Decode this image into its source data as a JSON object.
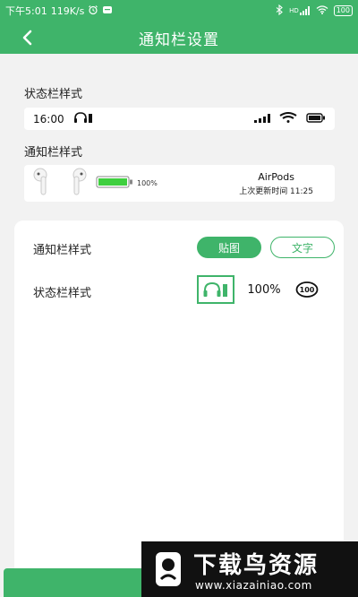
{
  "status_bar": {
    "time": "下午5:01",
    "speed": "119K/s",
    "signal_label": "HD",
    "battery": "100"
  },
  "header": {
    "title": "通知栏设置"
  },
  "preview": {
    "statusbar_section_label": "状态栏样式",
    "statusbar_time": "16:00",
    "notification_section_label": "通知栏样式",
    "notif_battery_pct": "100%",
    "device_name": "AirPods",
    "last_update": "上次更新时间 11:25"
  },
  "settings": {
    "notification_style_label": "通知栏样式",
    "mode_options": [
      "贴图",
      "文字"
    ],
    "selected_mode": "贴图",
    "statusbar_style_label": "状态栏样式",
    "statusbar_options": [
      "headphone-battery-icon",
      "100%",
      "100"
    ],
    "selected_statusbar_option": "headphone-battery-icon"
  },
  "watermark": {
    "title": "下载鸟资源",
    "url": "www.xiazainiao.com"
  },
  "colors": {
    "accent": "#3fb46a",
    "background": "#f2f2f2"
  }
}
